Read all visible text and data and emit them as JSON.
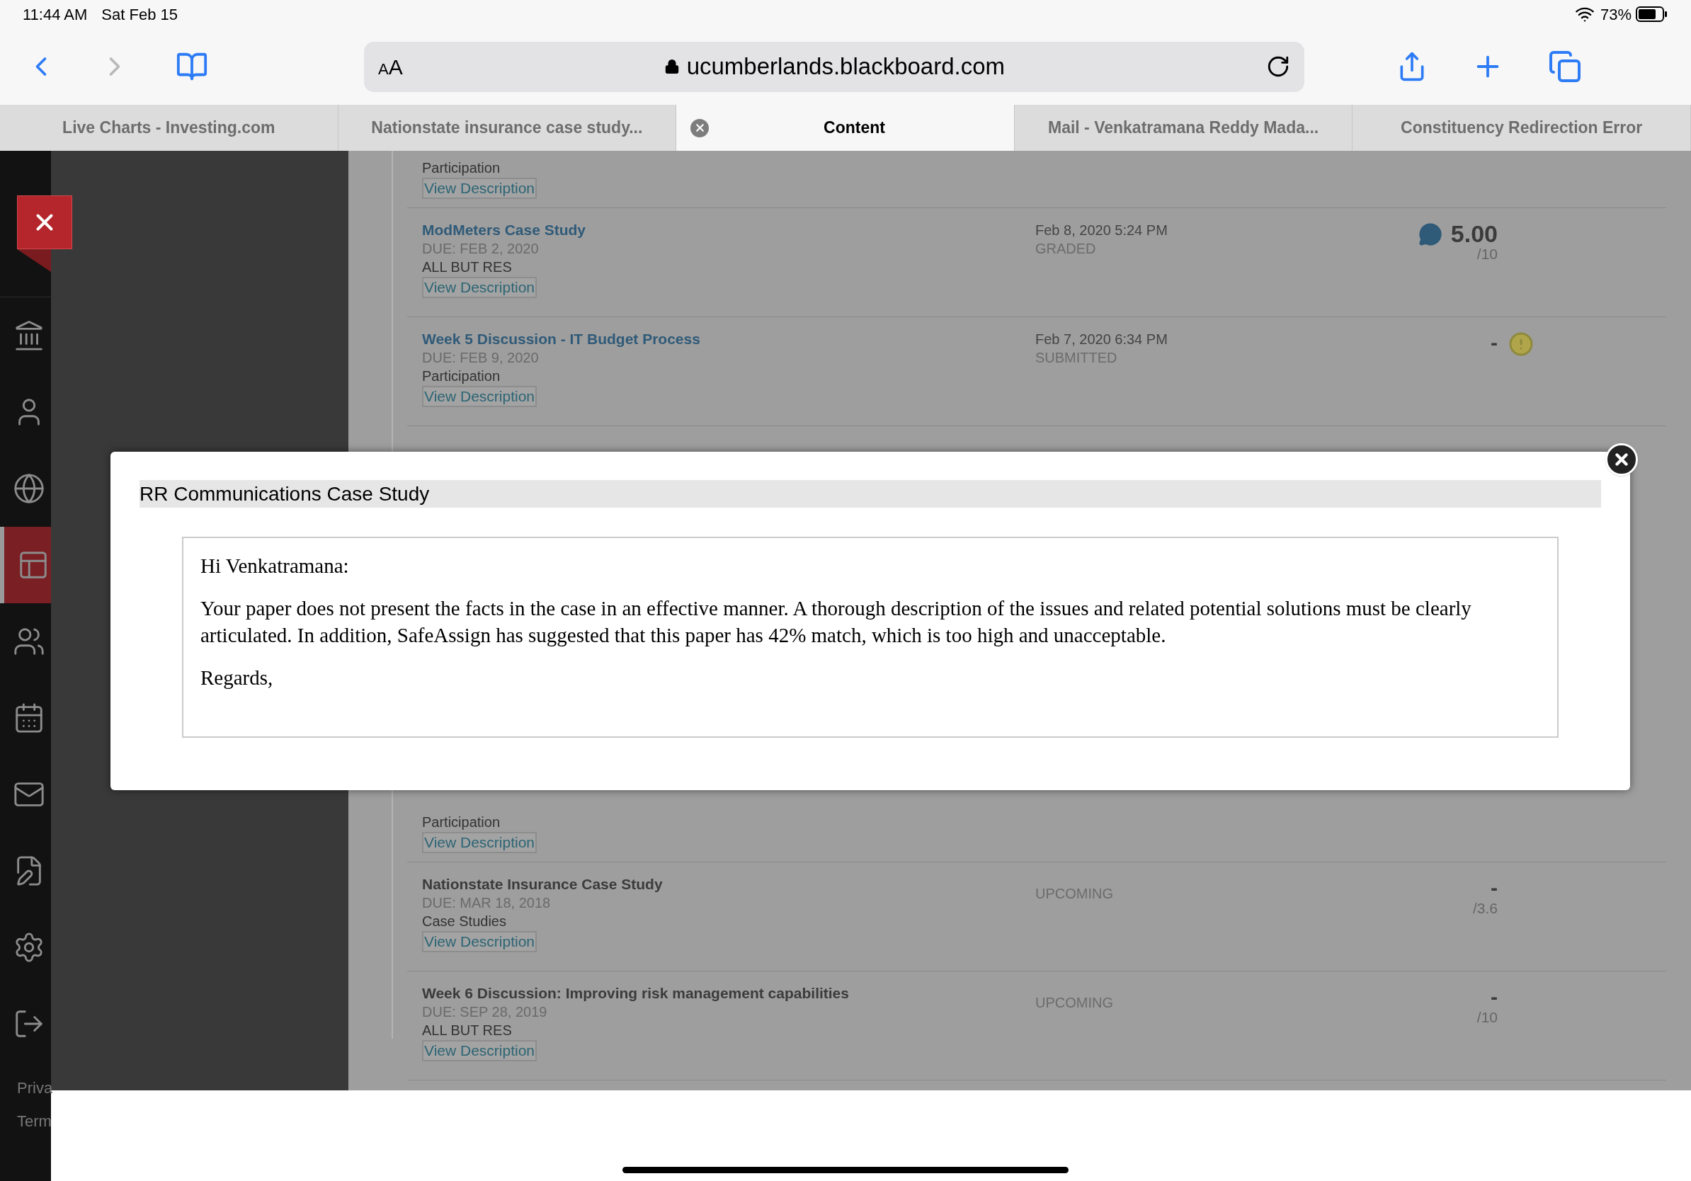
{
  "status_bar": {
    "time": "11:44 AM",
    "date": "Sat Feb 15",
    "battery": "73%"
  },
  "toolbar": {
    "forward_disabled": true,
    "text_size": [
      "A",
      "A"
    ],
    "url": "ucumberlands.blackboard.com"
  },
  "tabs": [
    {
      "label": "Live Charts - Investing.com",
      "selected": false
    },
    {
      "label": "Nationstate insurance case study...",
      "selected": false
    },
    {
      "label": "Content",
      "selected": true
    },
    {
      "label": "Mail - Venkatramana Reddy Mada...",
      "selected": false
    },
    {
      "label": "Constituency Redirection Error",
      "selected": false
    }
  ],
  "sidebar": {
    "items": [
      {
        "selected": false
      },
      {
        "selected": false
      },
      {
        "selected": false
      },
      {
        "selected": true
      },
      {
        "selected": false
      },
      {
        "selected": false
      },
      {
        "selected": false
      },
      {
        "selected": false
      },
      {
        "selected": false
      },
      {
        "selected": false
      }
    ],
    "footer": [
      "Priva",
      "Term"
    ]
  },
  "grades": [
    {
      "category": "Participation",
      "link": "View Description"
    },
    {
      "title": "ModMeters Case Study",
      "title_link": true,
      "due": "DUE: FEB 2, 2020",
      "category": "ALL BUT RES",
      "link": "View Description",
      "date": "Feb 8, 2020 5:24 PM",
      "status": "GRADED",
      "score": "5.00",
      "out_of": "/10",
      "kind": "commented"
    },
    {
      "title": "Week 5 Discussion - IT Budget Process",
      "title_link": true,
      "due": "DUE: FEB 9, 2020",
      "category": "Participation",
      "link": "View Description",
      "date": "Feb 7, 2020 6:34 PM",
      "status": "SUBMITTED",
      "score": "-",
      "kind": "alert"
    },
    {
      "kind": "hidden"
    },
    {
      "kind": "hidden"
    },
    {
      "kind": "hidden"
    },
    {
      "category": "Participation",
      "link": "View Description"
    },
    {
      "title": "Nationstate Insurance Case Study",
      "title_link": false,
      "due": "DUE: MAR 18, 2018",
      "category": "Case Studies",
      "link": "View Description",
      "status": "UPCOMING",
      "score": "-",
      "out_of": "/3.6"
    },
    {
      "title": "Week 6 Discussion: Improving risk management capabilities",
      "title_link": false,
      "due": "DUE: SEP 28, 2019",
      "category": "ALL BUT RES",
      "link": "View Description",
      "status": "UPCOMING",
      "score": "-",
      "out_of": "/10"
    }
  ],
  "modal": {
    "title": "RR Communications Case Study",
    "paragraphs": [
      "Hi Venkatramana:",
      "Your paper does not present the facts in the case in an effective manner. A thorough description of the issues and related potential solutions must be clearly articulated. In addition, SafeAssign has suggested that this paper has 42% match, which is too high and unacceptable.",
      "Regards,"
    ]
  }
}
